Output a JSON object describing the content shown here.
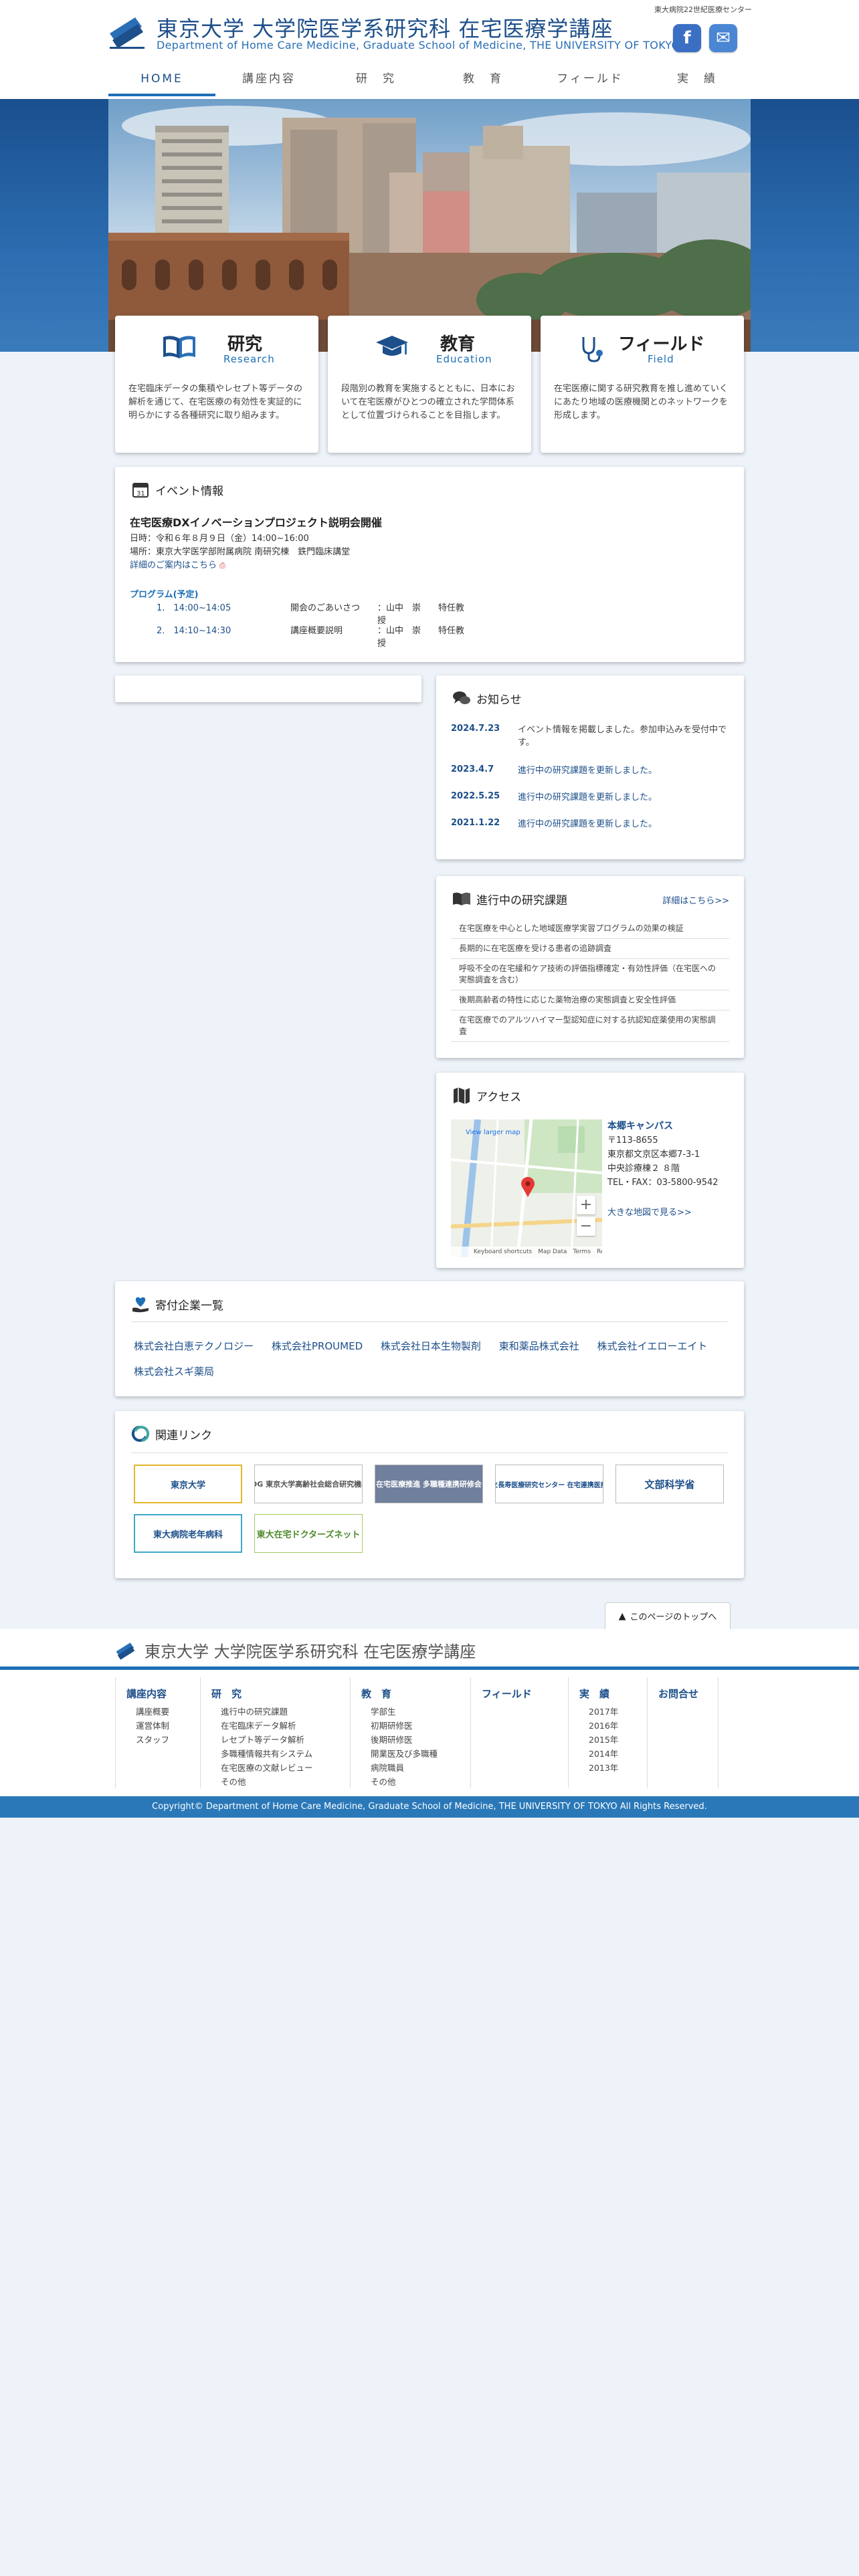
{
  "header": {
    "top_right": "東大病院22世紀医療センター",
    "logo_ja": "東京大学 大学院医学系研究科 在宅医療学講座",
    "logo_en": "Department of Home Care Medicine, Graduate School of Medicine, THE UNIVERSITY OF TOKYO",
    "facebook_glyph": "f",
    "mail_glyph": "✉",
    "nav": [
      "HOME",
      "講座内容",
      "研　究",
      "教　育",
      "フィールド",
      "実　績"
    ]
  },
  "features": [
    {
      "ja": "研究",
      "en": "Research",
      "icon": "book-icon",
      "text": "在宅臨床データの集積やレセプト等データの解析を通じて、在宅医療の有効性を実証的に明らかにする各種研究に取り組みます。"
    },
    {
      "ja": "教育",
      "en": "Education",
      "icon": "graduation-cap-icon",
      "text": "段階別の教育を実施するとともに、日本において在宅医療がひとつの確立された学問体系として位置づけられることを目指します。"
    },
    {
      "ja": "フィールド",
      "en": "Field",
      "icon": "stethoscope-icon",
      "text": "在宅医療に関する研究教育を推し進めていくにあたり地域の医療機関とのネットワークを形成します。"
    }
  ],
  "event": {
    "title": "イベント情報",
    "heading": "在宅医療DXイノベーションプロジェクト説明会開催",
    "date": "日時：令和６年８月９日（金）14:00~16:00",
    "place": "場所：東京大学医学部附属病院 南研究棟　鉄門臨床講堂",
    "detail_link": "詳細のご案内はこちら",
    "program_title": "プログラム(予定)",
    "program": [
      {
        "time": "1.　14:00~14:05",
        "desc": "開会のごあいさつ",
        "person": "：山中　崇　　特任教授"
      },
      {
        "time": "2.　14:10~14:30",
        "desc": "講座概要説明",
        "person": "：山中　崇　　特任教授"
      }
    ]
  },
  "news": {
    "title": "お知らせ",
    "items": [
      {
        "date": "2024.7.23",
        "text": "イベント情報を掲載しました。参加申込みを受付中です。"
      },
      {
        "date": "2023.4.7",
        "text": "進行中の研究課題を更新しました。"
      },
      {
        "date": "2022.5.25",
        "text": "進行中の研究課題を更新しました。"
      },
      {
        "date": "2021.1.22",
        "text": "進行中の研究課題を更新しました。"
      }
    ]
  },
  "research": {
    "title": "進行中の研究課題",
    "more": "詳細はこちら>>",
    "items": [
      "在宅医療を中心とした地域医療学実習プログラムの効果の検証",
      "長期的に在宅医療を受ける患者の追跡調査",
      "呼吸不全の在宅緩和ケア技術の評価指標確定・有効性評価（在宅医への実態調査を含む）",
      "後期高齢者の特性に応じた薬物治療の実態調査と安全性評価",
      "在宅医療でのアルツハイマー型認知症に対する抗認知症薬使用の実態調査"
    ]
  },
  "access": {
    "title": "アクセス",
    "map_link": "View larger map",
    "map_attr": "Keyboard shortcuts　Map Data　Terms　Report a map error",
    "campus": "本郷キャンパス",
    "zip": "〒113-8655",
    "address1": "東京都文京区本郷7-3-1",
    "address2": "中央診療棟２ ８階",
    "tel": "TEL・FAX：03-5800-9542",
    "big_map": "大きな地図で見る>>"
  },
  "donors": {
    "title": "寄付企業一覧",
    "companies": [
      "株式会社白恵テクノロジー",
      "株式会社PROUMED",
      "株式会社日本生物製剤",
      "東和薬品株式会社",
      "株式会社イエローエイト",
      "株式会社スギ薬局"
    ]
  },
  "links": {
    "title": "関連リンク",
    "banners": [
      "東京大学",
      "IOG 東京大学高齢社会総合研究機構",
      "在宅医療推進 多職種連携研修会",
      "国立長寿医療研究センター 在宅連携医療部",
      "文部科学省",
      "東大病院老年病科",
      "東大在宅ドクターズネット"
    ]
  },
  "totop": "このページのトップへ",
  "footer": {
    "logo_text": "東京大学 大学院医学系研究科 在宅医療学講座",
    "columns": [
      {
        "head": "講座内容",
        "items": [
          "講座概要",
          "運営体制",
          "スタッフ"
        ]
      },
      {
        "head": "研　究",
        "items": [
          "進行中の研究課題",
          "在宅臨床データ解析",
          "レセプト等データ解析",
          "多職種情報共有システム",
          "在宅医療の文献レビュー",
          "その他"
        ]
      },
      {
        "head": "教　育",
        "items": [
          "学部生",
          "初期研修医",
          "後期研修医",
          "開業医及び多職種",
          "病院職員",
          "その他"
        ]
      },
      {
        "head": "フィールド",
        "items": []
      },
      {
        "head": "実　績",
        "items": [
          "2017年",
          "2016年",
          "2015年",
          "2014年",
          "2013年"
        ]
      },
      {
        "head": "お問合せ",
        "items": []
      }
    ],
    "copyright": "Copyright© Department of Home Care Medicine, Graduate School of Medicine, THE UNIVERSITY OF TOKYO All Rights Reserved."
  }
}
